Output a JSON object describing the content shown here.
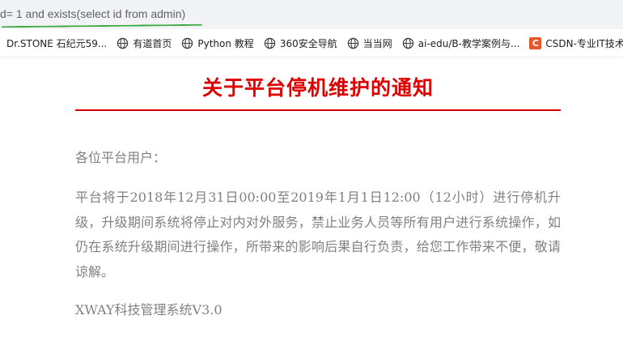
{
  "browser": {
    "url_text": "d= 1 and exists(select id from admin)",
    "bookmarks": [
      {
        "label": "Dr.STONE 石纪元59...",
        "icon": "none"
      },
      {
        "label": "有道首页",
        "icon": "globe-icon"
      },
      {
        "label": "Python 教程",
        "icon": "globe-icon"
      },
      {
        "label": "360安全导航",
        "icon": "globe-icon"
      },
      {
        "label": "当当网",
        "icon": "globe-icon"
      },
      {
        "label": "ai-edu/B-教学案例与...",
        "icon": "globe-icon"
      },
      {
        "label": "CSDN-专业IT技术",
        "icon": "csdn-icon",
        "icon_text": "C"
      }
    ]
  },
  "page": {
    "title": "关于平台停机维护的通知",
    "greeting": "各位平台用户：",
    "body": "平台将于2018年12月31日00:00至2019年1月1日12:00（12小时）进行停机升级，升级期间系统将停止对内对外服务，禁止业务人员等所有用户进行系统操作，如仍在系统升级期间进行操作，所带来的影响后果自行负责，给您工作带来不便，敬请谅解。",
    "signature": "XWAY科技管理系统V3.0"
  },
  "colors": {
    "title": "#e00000",
    "rule": "#d60000",
    "text": "#808080",
    "url_underline": "#3aa83a",
    "csdn_icon": "#e8572b"
  }
}
